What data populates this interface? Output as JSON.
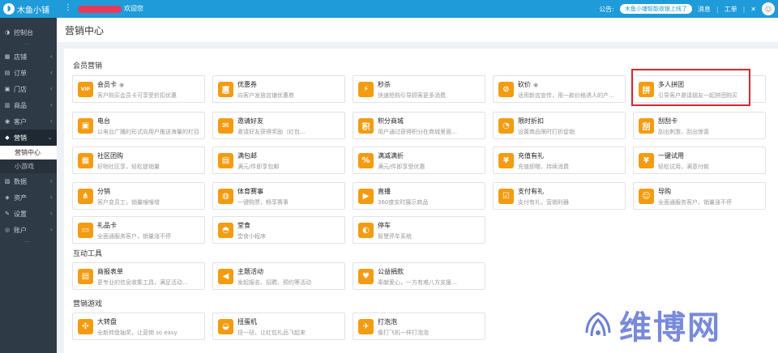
{
  "app": {
    "name": "木鱼小铺",
    "welcome": "欢迎您"
  },
  "topbar": {
    "notice_label": "公告:",
    "notice_text": "木鱼小铺智能收银上线了",
    "messages": "消息",
    "orders": "工单"
  },
  "sidebar": {
    "items": [
      {
        "icon": "◑",
        "label": "控制台"
      },
      {
        "icon": "▦",
        "label": "店铺"
      },
      {
        "icon": "▤",
        "label": "订单"
      },
      {
        "icon": "▣",
        "label": "门店"
      },
      {
        "icon": "▥",
        "label": "商品"
      },
      {
        "icon": "◉",
        "label": "客户"
      },
      {
        "icon": "◆",
        "label": "营销"
      },
      {
        "icon": "▧",
        "label": "数据"
      },
      {
        "icon": "◈",
        "label": "资产"
      },
      {
        "icon": "✎",
        "label": "设置"
      },
      {
        "icon": "◎",
        "label": "账户"
      }
    ],
    "sub_items": [
      "营销中心",
      "小游戏"
    ]
  },
  "page": {
    "title": "营销中心"
  },
  "sections": {
    "member": "会员营销",
    "interaction": "互动工具",
    "games": "营销游戏"
  },
  "cards": {
    "r1": [
      {
        "name": "会员卡",
        "desc": "客户购买会员卡可享受折扣优惠",
        "icon": "VIP",
        "color": "#f39c12"
      },
      {
        "name": "优惠券",
        "desc": "向客户发放店铺优惠券",
        "icon": "惠",
        "color": "#f39c12"
      },
      {
        "name": "秒杀",
        "desc": "快速抢购引导顾客更多消费",
        "icon": "⚡",
        "color": "#f39c12"
      },
      {
        "name": "砍价",
        "desc": "适用新店宣传，用一款价格诱人的产…",
        "icon": "⊘",
        "color": "#f39c12"
      },
      {
        "name": "多人拼团",
        "desc": "引导客户邀请朋友一起拼团购买",
        "icon": "拼",
        "color": "#f39c12"
      }
    ],
    "r2": [
      {
        "name": "电台",
        "desc": "以电台广播的形式向用户推送海量的栏目",
        "icon": "▣",
        "color": "#f39c12"
      },
      {
        "name": "邀请好友",
        "desc": "邀请好友获得奖励（红包…",
        "icon": "✉",
        "color": "#f39c12"
      },
      {
        "name": "积分商城",
        "desc": "用户通过获得积分在商城里面…",
        "icon": "积",
        "color": "#f39c12"
      },
      {
        "name": "限时折扣",
        "desc": "设置商品限时打折促销",
        "icon": "◔",
        "color": "#f39c12"
      },
      {
        "name": "刮刮卡",
        "desc": "刮出刺激，刮出惊喜",
        "icon": "刮",
        "color": "#f39c12"
      }
    ],
    "r3": [
      {
        "name": "社区团购",
        "desc": "好物社区享，轻松提销量",
        "icon": "▦",
        "color": "#f39c12"
      },
      {
        "name": "满包邮",
        "desc": "满元/件即享包邮",
        "icon": "▤",
        "color": "#f39c12"
      },
      {
        "name": "满减满折",
        "desc": "满元/件即享受优惠",
        "icon": "%",
        "color": "#f39c12"
      },
      {
        "name": "充值有礼",
        "desc": "充值即赠，持续消费",
        "icon": "¥",
        "color": "#f39c12"
      },
      {
        "name": "一键试用",
        "desc": "轻松试用，满意付款",
        "icon": "¥",
        "color": "#f39c12"
      }
    ],
    "r4": [
      {
        "name": "分销",
        "desc": "客户变员工，销量嗖嗖增",
        "icon": "⋔",
        "color": "#f39c12"
      },
      {
        "name": "体育赛事",
        "desc": "一键购票，畅享赛事",
        "icon": "◍",
        "color": "#f39c12"
      },
      {
        "name": "直播",
        "desc": "360度实时展示商品",
        "icon": "▶",
        "color": "#f39c12"
      },
      {
        "name": "支付有礼",
        "desc": "支付有礼，营销利器",
        "icon": "☑",
        "color": "#f39c12"
      },
      {
        "name": "导购",
        "desc": "全面通服务客户，销量涨不停",
        "icon": "☺",
        "color": "#f39c12"
      }
    ],
    "r5": [
      {
        "name": "礼品卡",
        "desc": "全面通服务客户，销量涨不停",
        "icon": "▭",
        "color": "#f39c12"
      },
      {
        "name": "堂食",
        "desc": "堂食小程序",
        "icon": "◓",
        "color": "#f39c12"
      },
      {
        "name": "停车",
        "desc": "智慧停车系统",
        "icon": "◐",
        "color": "#f39c12"
      }
    ],
    "r6": [
      {
        "name": "商报表单",
        "desc": "更专业的信息收集工具，满足活动…",
        "icon": "▤",
        "color": "#f39c12"
      },
      {
        "name": "主题活动",
        "desc": "发起报名、招聘、预约等活动",
        "icon": "◀",
        "color": "#f39c12"
      },
      {
        "name": "公益捐款",
        "desc": "奉献爱心，一方有难八方支援…",
        "icon": "♥",
        "color": "#f39c12"
      }
    ],
    "r7": [
      {
        "name": "大转盘",
        "desc": "全新转盘抽奖，让营销 so easy",
        "icon": "✣",
        "color": "#f39c12"
      },
      {
        "name": "扭蛋机",
        "desc": "扭一扭，让红包礼品飞起来",
        "icon": "◒",
        "color": "#f39c12"
      },
      {
        "name": "打泡泡",
        "desc": "像打飞机一样打泡泡",
        "icon": "✈",
        "color": "#f39c12"
      }
    ]
  },
  "watermark": {
    "text": "维博网"
  }
}
